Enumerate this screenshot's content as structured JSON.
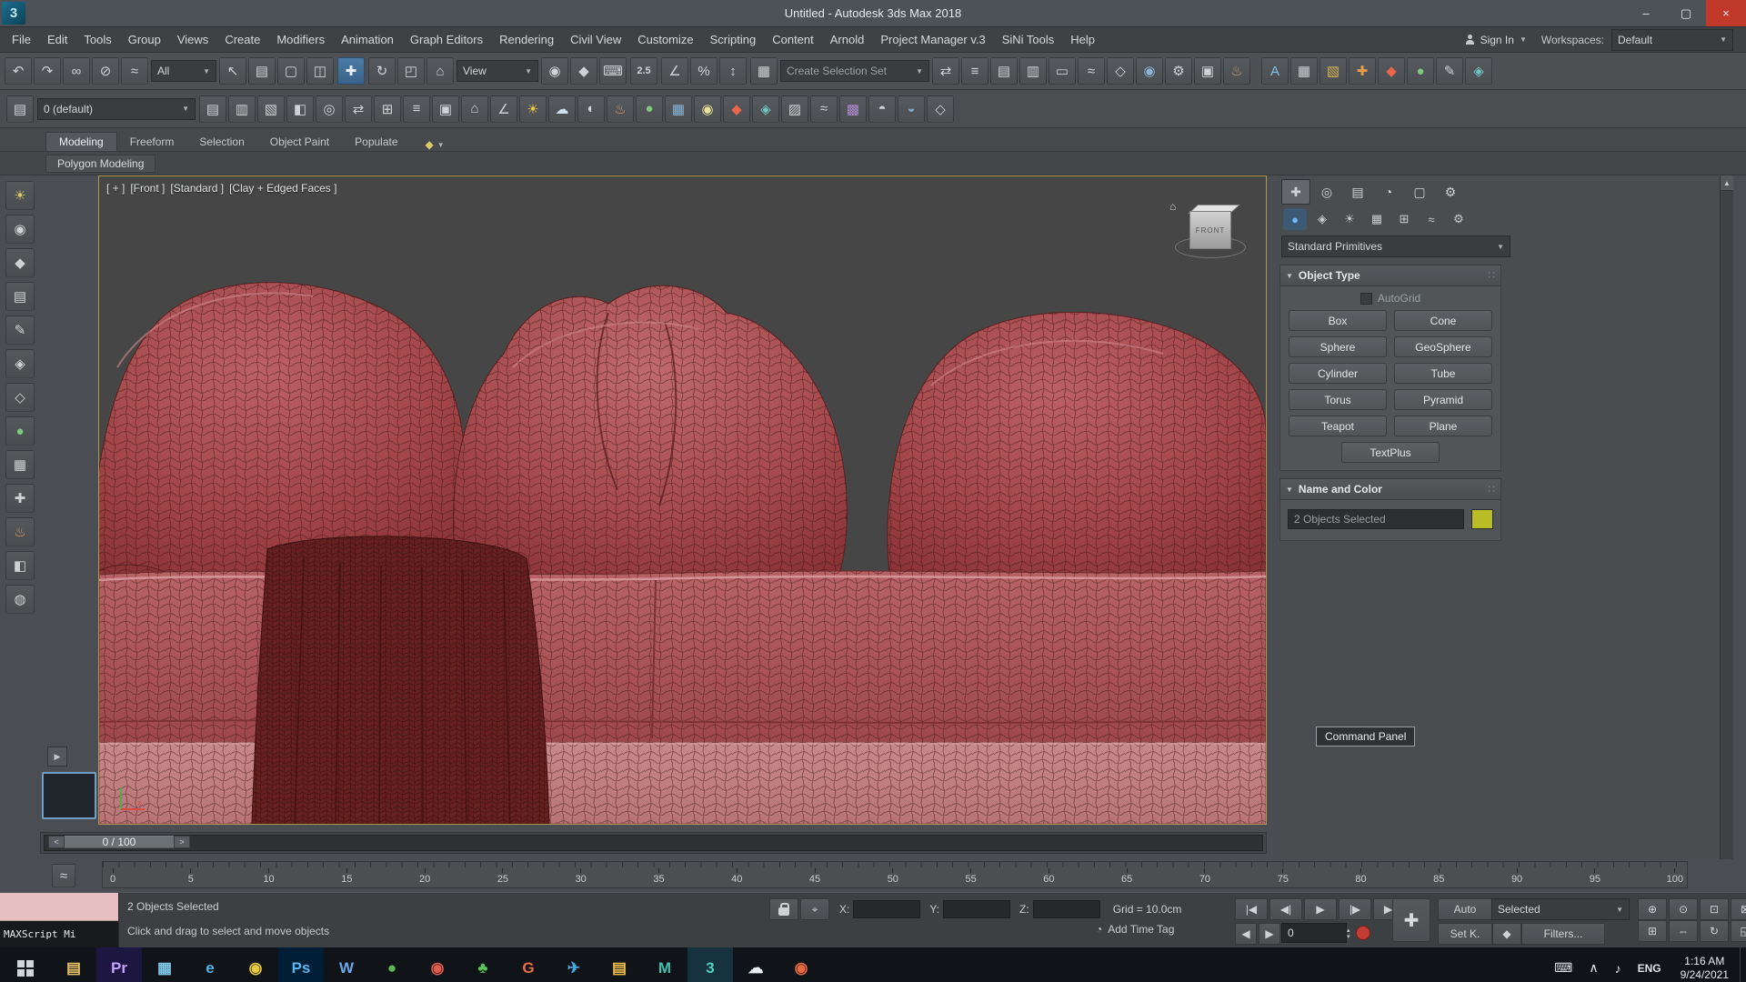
{
  "window": {
    "title": "Untitled - Autodesk 3ds Max 2018",
    "app_badge": "3",
    "min": "–",
    "max": "▢",
    "close": "×"
  },
  "menubar": {
    "items": [
      "File",
      "Edit",
      "Tools",
      "Group",
      "Views",
      "Create",
      "Modifiers",
      "Animation",
      "Graph Editors",
      "Rendering",
      "Civil View",
      "Customize",
      "Scripting",
      "Content",
      "Arnold",
      "Project Manager v.3",
      "SiNi Tools",
      "Help"
    ],
    "sign_in": "Sign In",
    "workspaces_label": "Workspaces:",
    "workspace_value": "Default"
  },
  "toolbar1": {
    "iconsA": [
      {
        "n": "undo-icon",
        "g": "↶"
      },
      {
        "n": "redo-icon",
        "g": "↷"
      },
      {
        "n": "select-and-link-icon",
        "g": "∞"
      },
      {
        "n": "unlink-selection-icon",
        "g": "⊘"
      },
      {
        "n": "bind-to-space-warp-icon",
        "g": "≈"
      }
    ],
    "filter_value": "All",
    "iconsB": [
      {
        "n": "select-object-icon",
        "g": "↖"
      },
      {
        "n": "select-by-name-icon",
        "g": "▤"
      },
      {
        "n": "rectangular-selection-region-icon",
        "g": "▢"
      },
      {
        "n": "window-crossing-icon",
        "g": "◫"
      }
    ],
    "move": {
      "n": "select-and-move-icon",
      "g": "✚"
    },
    "iconsC": [
      {
        "n": "select-and-rotate-icon",
        "g": "↻"
      },
      {
        "n": "select-and-scale-icon",
        "g": "◰"
      },
      {
        "n": "select-and-place-icon",
        "g": "⌂"
      }
    ],
    "ref_coord_value": "View",
    "iconsD": [
      {
        "n": "use-pivot-point-center-icon",
        "g": "◉"
      },
      {
        "n": "select-and-manipulate-icon",
        "g": "◆"
      },
      {
        "n": "keyboard-shortcut-override-icon",
        "g": "⌨"
      }
    ],
    "snap_label": "2.5",
    "iconsE": [
      {
        "n": "angle-snap-icon",
        "g": "∠"
      },
      {
        "n": "percent-snap-icon",
        "g": "%"
      },
      {
        "n": "spinner-snap-icon",
        "g": "↕"
      }
    ],
    "iconsF": [
      {
        "n": "edit-named-selection-sets-icon",
        "g": "▦"
      }
    ],
    "selection_set_value": "Create Selection Set",
    "iconsG": [
      {
        "n": "mirror-icon",
        "g": "⇄"
      },
      {
        "n": "align-icon",
        "g": "≡"
      },
      {
        "n": "toggle-scene-explorer-icon",
        "g": "▤"
      },
      {
        "n": "toggle-layer-explorer-icon",
        "g": "▥"
      },
      {
        "n": "toggle-ribbon-icon",
        "g": "▭"
      },
      {
        "n": "curve-editor-icon",
        "g": "≈"
      },
      {
        "n": "schematic-view-icon",
        "g": "◇"
      },
      {
        "n": "material-editor-icon",
        "g": "◉",
        "c": "#89b4d9"
      },
      {
        "n": "render-setup-icon",
        "g": "⚙"
      },
      {
        "n": "rendered-frame-window-icon",
        "g": "▣"
      },
      {
        "n": "render-production-icon",
        "g": "♨",
        "c": "#d9a066"
      }
    ],
    "iconsH": [
      {
        "n": "render-in-arnold-icon",
        "g": "A",
        "c": "#7ec3e8"
      },
      {
        "n": "state-sets-icon",
        "g": "▦"
      },
      {
        "n": "project-manager-icon",
        "g": "▧",
        "c": "#d8b35a"
      },
      {
        "n": "sini-forensic-icon",
        "g": "✚",
        "c": "#e89a4a"
      },
      {
        "n": "sini-ignite-icon",
        "g": "◆",
        "c": "#e8674a"
      },
      {
        "n": "sini-proxy-icon",
        "g": "●",
        "c": "#7fc97f"
      },
      {
        "n": "sini-scribe-icon",
        "g": "✎"
      },
      {
        "n": "sini-disperse-icon",
        "g": "◈",
        "c": "#6fc3c3"
      }
    ]
  },
  "toolbar2": {
    "layer_icon": {
      "n": "layer-manager-icon",
      "g": "▤"
    },
    "layer_value": "0 (default)",
    "icons": [
      {
        "n": "new-scene-explorer-icon",
        "g": "▤"
      },
      {
        "n": "open-explorer-icon",
        "g": "▥"
      },
      {
        "n": "display-floater-icon",
        "g": "▧"
      },
      {
        "n": "manage-layers-icon",
        "g": "◧"
      },
      {
        "n": "isolate-selection-icon",
        "g": "◎"
      },
      {
        "n": "mirror-tool-icon",
        "g": "⇄"
      },
      {
        "n": "array-tool-icon",
        "g": "⊞"
      },
      {
        "n": "align-tool-icon",
        "g": "≡"
      },
      {
        "n": "snapshot-icon",
        "g": "▣"
      },
      {
        "n": "units-setup-icon",
        "g": "⌂"
      },
      {
        "n": "measure-distance-icon",
        "g": "∠"
      },
      {
        "n": "sun-positioner-icon",
        "g": "☀",
        "c": "#e8c93e"
      },
      {
        "n": "environment-icon",
        "g": "☁",
        "c": "#cfe3f0"
      },
      {
        "n": "exposure-control-icon",
        "g": "◐"
      },
      {
        "n": "render-preview-icon",
        "g": "♨",
        "c": "#d9a066"
      },
      {
        "n": "material-override-icon",
        "g": "●",
        "c": "#7fc97f"
      },
      {
        "n": "physical-camera-icon",
        "g": "▦",
        "c": "#89b4d9"
      },
      {
        "n": "light-lister-icon",
        "g": "◉",
        "c": "#e8e29a"
      },
      {
        "n": "proxy-tool-icon",
        "g": "◆",
        "c": "#e8674a"
      },
      {
        "n": "point-cloud-icon",
        "g": "◈",
        "c": "#6fc3c3"
      },
      {
        "n": "container-tool-icon",
        "g": "▨"
      },
      {
        "n": "path-deform-icon",
        "g": "≈"
      },
      {
        "n": "cloth-tool-icon",
        "g": "▩",
        "c": "#b08ad1"
      },
      {
        "n": "hair-tool-icon",
        "g": "◓"
      },
      {
        "n": "fluid-tool-icon",
        "g": "◒",
        "c": "#7aa7c7"
      },
      {
        "n": "mcg-tool-icon",
        "g": "◇"
      }
    ]
  },
  "ribbon": {
    "tabs": [
      {
        "label": "Modeling",
        "active": true
      },
      {
        "label": "Freeform"
      },
      {
        "label": "Selection"
      },
      {
        "label": "Object Paint"
      },
      {
        "label": "Populate"
      }
    ],
    "section": "Polygon Modeling"
  },
  "left_toolbar": {
    "icons": [
      {
        "n": "sini-illumi-icon",
        "g": "☀",
        "c": "#d9c96a"
      },
      {
        "n": "sini-sculpt-icon",
        "g": "◉"
      },
      {
        "n": "sini-proxsi-icon",
        "g": "◆"
      },
      {
        "n": "sini-analytics-icon",
        "g": "▤"
      },
      {
        "n": "sini-scribe-icon",
        "g": "✎"
      },
      {
        "n": "sini-disperse-icon",
        "g": "◈"
      },
      {
        "n": "sini-polygon-icon",
        "g": "◇"
      },
      {
        "n": "sini-sphere-icon",
        "g": "●",
        "c": "#7fc97f"
      },
      {
        "n": "sini-scatter-icon",
        "g": "▦"
      },
      {
        "n": "sini-forensic-icon",
        "g": "✚"
      },
      {
        "n": "sini-ignite-icon",
        "g": "♨",
        "c": "#d9a066"
      },
      {
        "n": "sini-paint-icon",
        "g": "◧"
      },
      {
        "n": "sini-lamp-icon",
        "g": "◍"
      }
    ]
  },
  "viewport": {
    "label_segments": [
      "[ + ]",
      "[Front ]",
      "[Standard ]",
      "[Clay + Edged Faces ]"
    ],
    "viewcube_label": "FRONT",
    "axis_label": "x"
  },
  "layout_strip": {
    "expand_arrow": "▶"
  },
  "command_panel": {
    "tabs": [
      {
        "n": "create-tab",
        "g": "✚",
        "active": true
      },
      {
        "n": "modify-tab",
        "g": "◎"
      },
      {
        "n": "hierarchy-tab",
        "g": "▤"
      },
      {
        "n": "motion-tab",
        "g": "◔"
      },
      {
        "n": "display-tab",
        "g": "▢"
      },
      {
        "n": "utilities-tab",
        "g": "⚙"
      }
    ],
    "categories": [
      {
        "n": "geometry-category",
        "g": "●",
        "active": true
      },
      {
        "n": "shapes-category",
        "g": "◈"
      },
      {
        "n": "lights-category",
        "g": "☀"
      },
      {
        "n": "cameras-category",
        "g": "▦"
      },
      {
        "n": "helpers-category",
        "g": "⊞"
      },
      {
        "n": "space-warps-category",
        "g": "≈"
      },
      {
        "n": "systems-category",
        "g": "⚙"
      }
    ],
    "dropdown_value": "Standard Primitives",
    "object_type": {
      "title": "Object Type",
      "autogrid_label": "AutoGrid",
      "buttons": [
        "Box",
        "Cone",
        "Sphere",
        "GeoSphere",
        "Cylinder",
        "Tube",
        "Torus",
        "Pyramid",
        "Teapot",
        "Plane",
        "TextPlus"
      ]
    },
    "name_color": {
      "title": "Name and Color",
      "name_value": "2 Objects Selected",
      "swatch_color": "#b9bd26"
    },
    "tooltip": "Command Panel",
    "scroll_up": "▲"
  },
  "timeline": {
    "slider_value": "0 / 100",
    "prev": "<",
    "next": ">",
    "ticks": [
      "0",
      "5",
      "10",
      "15",
      "20",
      "25",
      "30",
      "35",
      "40",
      "45",
      "50",
      "55",
      "60",
      "65",
      "70",
      "75",
      "80",
      "85",
      "90",
      "95",
      "100"
    ]
  },
  "status": {
    "maxscript": "MAXScript Mi",
    "selection": "2 Objects Selected",
    "prompt": "Click and drag to select and move objects",
    "x_label": "X:",
    "y_label": "Y:",
    "z_label": "Z:",
    "grid_label": "Grid = 10.0cm",
    "add_time_tag": "Add Time Tag",
    "time_tag_icon": "◔",
    "abs_mode_icon": "⌖",
    "auto_label": "Auto",
    "selected_value": "Selected",
    "set_key_label": "Set K.",
    "filters_label": "Filters...",
    "frame_value": "0",
    "set_keys_icon": "✚",
    "key_filter_icon": "◆",
    "spin_up": "▴",
    "spin_down": "▾",
    "mini_prev": "◀",
    "mini_next": "▶",
    "curve_editor_icon": "≈",
    "playback": [
      {
        "n": "go-to-start-button",
        "g": "|◀"
      },
      {
        "n": "previous-frame-button",
        "g": "◀|"
      },
      {
        "n": "play-button",
        "g": "▶"
      },
      {
        "n": "next-frame-button",
        "g": "|▶"
      },
      {
        "n": "go-to-end-button",
        "g": "▶|"
      }
    ],
    "nav_row1": [
      {
        "n": "zoom-icon",
        "g": "⊕"
      },
      {
        "n": "zoom-all-icon",
        "g": "⊙"
      },
      {
        "n": "zoom-extents-icon",
        "g": "⊡"
      },
      {
        "n": "zoom-region-icon",
        "g": "⊠"
      }
    ],
    "nav_row2": [
      {
        "n": "field-of-view-icon",
        "g": "⊞"
      },
      {
        "n": "pan-icon",
        "g": "⇔"
      },
      {
        "n": "orbit-icon",
        "g": "↻"
      },
      {
        "n": "maximize-viewport-toggle-icon",
        "g": "◱"
      }
    ]
  },
  "taskbar": {
    "time": "1:16 AM",
    "date": "9/24/2021",
    "lang": "ENG",
    "tray": {
      "keyboard": "⌨",
      "hidden_icons": "∧",
      "sound": "♪"
    },
    "apps": [
      {
        "n": "file-explorer",
        "g": "▤",
        "c": "#e8c468"
      },
      {
        "n": "premiere-pro",
        "g": "Pr",
        "c": "#c5a3ff",
        "bg": "#1d1640"
      },
      {
        "n": "calculator",
        "g": "▦",
        "c": "#7ec8e8"
      },
      {
        "n": "edge-browser",
        "g": "e",
        "c": "#4fb3e8"
      },
      {
        "n": "chrome",
        "g": "◉",
        "c": "#e8c93e"
      },
      {
        "n": "photoshop",
        "g": "Ps",
        "c": "#5ab6f2",
        "bg": "#001e36"
      },
      {
        "n": "word",
        "g": "W",
        "c": "#6aa6e8"
      },
      {
        "n": "globe-app",
        "g": "●",
        "c": "#58b858"
      },
      {
        "n": "obs-studio",
        "g": "◉",
        "c": "#e05a4e"
      },
      {
        "n": "oneup-game",
        "g": "♣",
        "c": "#58c858"
      },
      {
        "n": "g-app",
        "g": "G",
        "c": "#ea6a4a"
      },
      {
        "n": "telegram",
        "g": "✈",
        "c": "#45a8dd"
      },
      {
        "n": "folder-pinned",
        "g": "▤",
        "c": "#f2c14e"
      },
      {
        "n": "maya",
        "g": "M",
        "c": "#3fc1b0"
      },
      {
        "n": "3dsmax",
        "g": "3",
        "c": "#4fd1c5",
        "bg": "#17323f",
        "active": true
      },
      {
        "n": "onedrive",
        "g": "☁",
        "c": "#e8eef2"
      },
      {
        "n": "chrome-profile",
        "g": "◉",
        "c": "#e86a3e"
      }
    ]
  },
  "colors": {
    "accent": "#4b7ba6",
    "viewport_border": "#b1974e",
    "close_red": "#c0392b",
    "swatch": "#b9bd26"
  }
}
